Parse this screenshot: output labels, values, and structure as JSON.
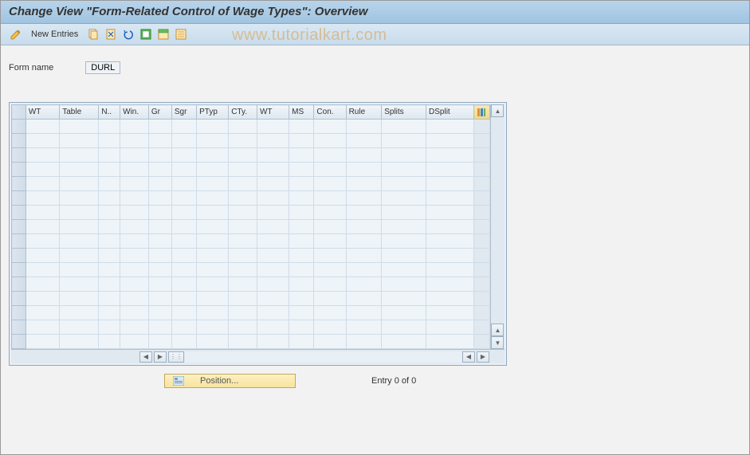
{
  "header": {
    "title": "Change View \"Form-Related Control of Wage Types\": Overview"
  },
  "toolbar": {
    "new_entries_label": "New Entries",
    "watermark": "www.tutorialkart.com"
  },
  "form": {
    "name_label": "Form name",
    "name_value": "DURL"
  },
  "table": {
    "columns": [
      "WT",
      "Table",
      "N..",
      "Win.",
      "Gr",
      "Sgr",
      "PTyp",
      "CTy.",
      "WT",
      "MS",
      "Con.",
      "Rule",
      "Splits",
      "DSplit"
    ],
    "row_count": 16
  },
  "footer": {
    "position_label": "Position...",
    "entry_text": "Entry 0 of 0"
  }
}
